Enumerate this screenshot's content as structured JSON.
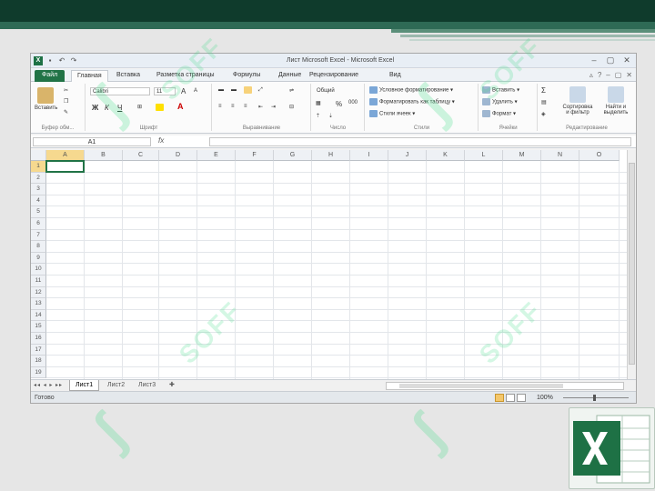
{
  "window": {
    "title": "Лист Microsoft Excel - Microsoft Excel"
  },
  "qat": {
    "undo": "↶",
    "redo": "↷",
    "save": "▪"
  },
  "tabs": [
    {
      "label": "Файл"
    },
    {
      "label": "Главная"
    },
    {
      "label": "Вставка"
    },
    {
      "label": "Разметка страницы"
    },
    {
      "label": "Формулы"
    },
    {
      "label": "Данные"
    },
    {
      "label": "Рецензирование"
    },
    {
      "label": "Вид"
    }
  ],
  "ribbon": {
    "clipboard": {
      "paste": "Вставить",
      "group": "Буфер обм..."
    },
    "font": {
      "name": "Calibri",
      "size": "11",
      "bold": "Ж",
      "italic": "К",
      "underline": "Ч",
      "grow": "A",
      "shrink": "A",
      "group": "Шрифт"
    },
    "alignment": {
      "group": "Выравнивание"
    },
    "number": {
      "format": "Общий",
      "percent": "%",
      "thousands": "000",
      "group": "Число"
    },
    "styles": {
      "conditional": "Условное форматирование",
      "table": "Форматировать как таблицу",
      "cell": "Стили ячеек",
      "group": "Стили"
    },
    "cells": {
      "insert": "Вставить",
      "delete": "Удалить",
      "format": "Формат",
      "group": "Ячейки"
    },
    "editing": {
      "sum": "Σ",
      "sort": "Сортировка\nи фильтр",
      "find": "Найти и\nвыделить",
      "group": "Редактирование"
    }
  },
  "formula_bar": {
    "name_box": "A1",
    "fx": "fx",
    "value": ""
  },
  "grid": {
    "columns": [
      "A",
      "B",
      "C",
      "D",
      "E",
      "F",
      "G",
      "H",
      "I",
      "J",
      "K",
      "L",
      "M",
      "N",
      "O"
    ],
    "rows": [
      "1",
      "2",
      "3",
      "4",
      "5",
      "6",
      "7",
      "8",
      "9",
      "10",
      "11",
      "12",
      "13",
      "14",
      "15",
      "16",
      "17",
      "18",
      "19"
    ],
    "selected_cell": "A1"
  },
  "sheets": [
    {
      "label": "Лист1",
      "active": true
    },
    {
      "label": "Лист2"
    },
    {
      "label": "Лист3"
    }
  ],
  "status": {
    "ready": "Готово",
    "zoom": "100%"
  },
  "colors": {
    "excel_green": "#217346",
    "header_bg": "#0f3b2c"
  },
  "watermark": "SOFF"
}
